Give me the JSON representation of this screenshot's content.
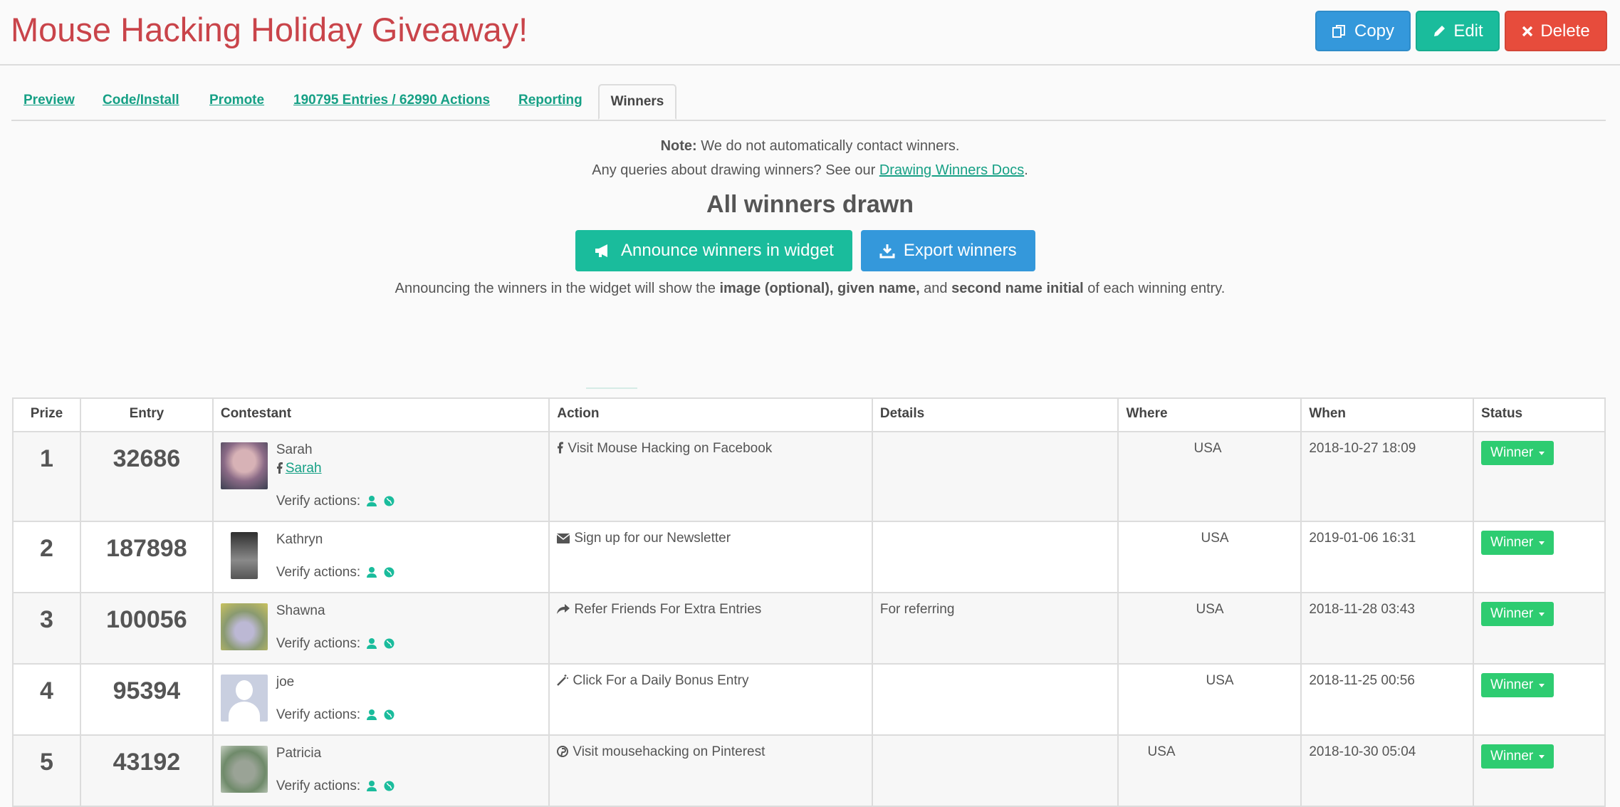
{
  "header": {
    "title": "Mouse Hacking Holiday Giveaway!",
    "copy_label": "Copy",
    "edit_label": "Edit",
    "delete_label": "Delete"
  },
  "tabs": [
    {
      "label": "Preview"
    },
    {
      "label": "Code/Install"
    },
    {
      "label": "Promote"
    },
    {
      "label": "190795 Entries / 62990 Actions"
    },
    {
      "label": "Reporting"
    },
    {
      "label": "Winners"
    }
  ],
  "notice": {
    "note_bold": "Note:",
    "note_text": " We do not automatically contact winners.",
    "queries_text": "Any queries about drawing winners? See our ",
    "docs_link": "Drawing Winners Docs",
    "queries_end": "."
  },
  "drawn": {
    "heading": "All winners drawn",
    "announce_label": "Announce winners in widget",
    "export_label": "Export winners",
    "info_pre": "Announcing the winners in the widget will show the ",
    "info_bold1": "image (optional), given name,",
    "info_mid": " and ",
    "info_bold2": "second name initial",
    "info_post": " of each winning entry."
  },
  "table": {
    "headers": {
      "prize": "Prize",
      "entry": "Entry",
      "contestant": "Contestant",
      "action": "Action",
      "details": "Details",
      "where": "Where",
      "when": "When",
      "status": "Status"
    },
    "verify_label": "Verify actions:",
    "rows": [
      {
        "prize": "1",
        "entry": "32686",
        "name": "Sarah",
        "fb_name": "Sarah",
        "action": "Visit Mouse Hacking on Facebook",
        "action_icon": "facebook-icon",
        "details": "",
        "where": "USA",
        "when": "2018-10-27 18:09",
        "status": "Winner"
      },
      {
        "prize": "2",
        "entry": "187898",
        "name": "Kathryn",
        "fb_name": "",
        "action": "Sign up for our Newsletter",
        "action_icon": "envelope-icon",
        "details": "",
        "where": "USA",
        "when": "2019-01-06 16:31",
        "status": "Winner"
      },
      {
        "prize": "3",
        "entry": "100056",
        "name": "Shawna",
        "fb_name": "",
        "action": "Refer Friends For Extra Entries",
        "action_icon": "share-icon",
        "details": "For referring",
        "where": "USA",
        "when": "2018-11-28 03:43",
        "status": "Winner"
      },
      {
        "prize": "4",
        "entry": "95394",
        "name": "joe",
        "fb_name": "",
        "action": "Click For a Daily Bonus Entry",
        "action_icon": "magic-wand-icon",
        "details": "",
        "where": "USA",
        "when": "2018-11-25 00:56",
        "status": "Winner"
      },
      {
        "prize": "5",
        "entry": "43192",
        "name": "Patricia",
        "fb_name": "",
        "action": "Visit mousehacking on Pinterest",
        "action_icon": "pinterest-icon",
        "details": "",
        "where": "USA",
        "when": "2018-10-30 05:04",
        "status": "Winner"
      }
    ]
  },
  "colors": {
    "title": "#c9444a",
    "link": "#16a085",
    "copy": "#3498db",
    "edit": "#1abc9c",
    "delete": "#e74c3c",
    "winner": "#2ecc71"
  }
}
